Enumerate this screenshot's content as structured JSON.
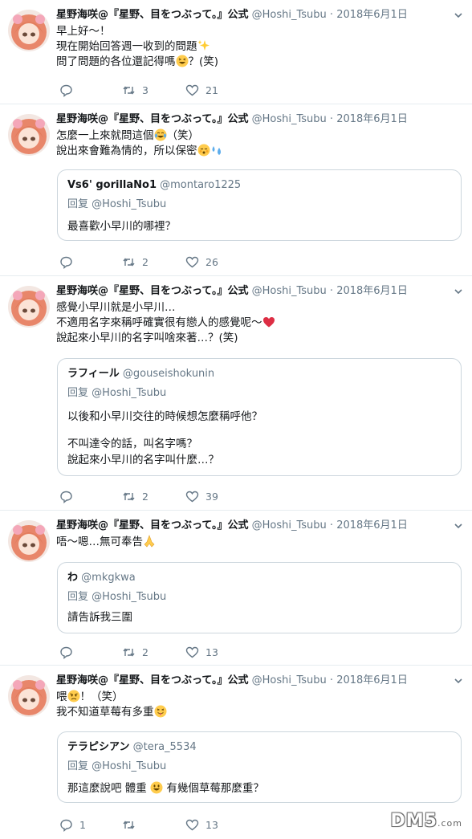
{
  "tweets": [
    {
      "name": "星野海咲@『星野、目をつぶって。』公式",
      "handle": "@Hoshi_Tsubu",
      "sep": "·",
      "date": "2018年6月1日",
      "lines": [
        "早上好～！",
        "現在開始回答週一收到的問題",
        "問了問題的各位還記得嗎",
        "？(笑)"
      ],
      "actions": {
        "reply": "",
        "retweet": "3",
        "like": "21"
      }
    },
    {
      "name": "星野海咲@『星野、目をつぶって。』公式",
      "handle": "@Hoshi_Tsubu",
      "sep": "·",
      "date": "2018年6月1日",
      "lines": [
        "怎麼一上來就問這個",
        "（笑）",
        "說出來會難為情的，所以保密"
      ],
      "quote": {
        "name": "Vs6' gorillaNo1",
        "handle": "@montaro1225",
        "reply": "回复 @Hoshi_Tsubu",
        "text": [
          "最喜歡小早川的哪裡？"
        ]
      },
      "actions": {
        "reply": "",
        "retweet": "2",
        "like": "26"
      }
    },
    {
      "name": "星野海咲@『星野、目をつぶって。』公式",
      "handle": "@Hoshi_Tsubu",
      "sep": "·",
      "date": "2018年6月1日",
      "lines": [
        "感覺小早川就是小早川…",
        "不適用名字來稱呼確實很有戀人的感覺呢～",
        "說起來小早川的名字叫啥來著…？(笑)"
      ],
      "quote": {
        "name": "ラフィール",
        "handle": "@gouseishokunin",
        "reply": "回复 @Hoshi_Tsubu",
        "text": [
          "以後和小早川交往的時候想怎麼稱呼他？",
          "",
          "不叫達令的話，叫名字嗎？",
          "說起來小早川的名字叫什麼…？"
        ]
      },
      "actions": {
        "reply": "",
        "retweet": "2",
        "like": "39"
      }
    },
    {
      "name": "星野海咲@『星野、目をつぶって。』公式",
      "handle": "@Hoshi_Tsubu",
      "sep": "·",
      "date": "2018年6月1日",
      "lines": [
        "唔～嗯…無可奉告"
      ],
      "quote": {
        "name": "わ",
        "handle": "@mkgkwa",
        "reply": "回复 @Hoshi_Tsubu",
        "text": [
          "請告訴我三圍"
        ]
      },
      "actions": {
        "reply": "",
        "retweet": "2",
        "like": "13"
      }
    },
    {
      "name": "星野海咲@『星野、目をつぶって。』公式",
      "handle": "@Hoshi_Tsubu",
      "sep": "·",
      "date": "2018年6月1日",
      "lines": [
        "喂",
        "！（笑）",
        "我不知道草莓有多重"
      ],
      "quote": {
        "name": "テラピシアン",
        "handle": "@tera_5534",
        "reply": "回复 @Hoshi_Tsubu",
        "text": [
          "那這麼說吧 體重",
          " 有幾個草莓那麼重？"
        ]
      },
      "actions": {
        "reply": "1",
        "retweet": "",
        "like": "13"
      }
    }
  ],
  "watermark": {
    "brand": "DM5",
    "suffix": ".com"
  },
  "colors": {
    "text": "#14171a",
    "muted": "#657786",
    "border": "#e6ecf0",
    "quoteBorder": "#ccd6dd"
  },
  "icons": [
    "reply-icon",
    "retweet-icon",
    "like-icon",
    "caret-down-icon"
  ]
}
